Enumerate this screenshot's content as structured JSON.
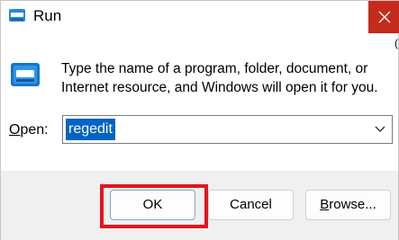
{
  "window": {
    "title": "Run",
    "close_icon": "close-icon",
    "edge_mark": "("
  },
  "description": "Type the name of a program, folder, document, or Internet resource, and Windows will open it for you.",
  "open_field": {
    "label_mnemonic": "O",
    "label_rest": "pen:",
    "value": "regedit",
    "dropdown_icon": "chevron-down-icon"
  },
  "buttons": {
    "ok": "OK",
    "cancel": "Cancel",
    "browse_mnemonic": "B",
    "browse_rest": "rowse..."
  },
  "colors": {
    "close_button": "#c42b1c",
    "selection": "#0063c5",
    "highlight_box": "#e5141e"
  }
}
